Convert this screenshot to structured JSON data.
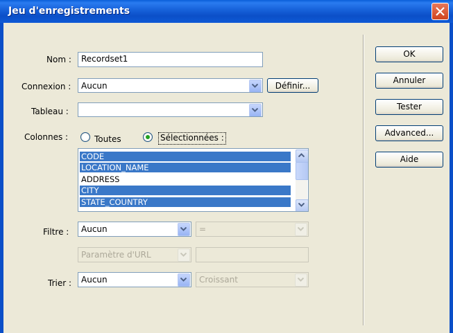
{
  "window": {
    "title": "Jeu d'enregistrements"
  },
  "form": {
    "name_label": "Nom :",
    "name_value": "Recordset1",
    "connection_label": "Connexion :",
    "connection_value": "Aucun",
    "define_button": "Définir...",
    "table_label": "Tableau :",
    "table_value": "",
    "columns_label": "Colonnes :",
    "radio_all_label": "Toutes",
    "radio_selected_label": "Sélectionnées :",
    "columns_list": [
      {
        "label": "CODE",
        "selected": true
      },
      {
        "label": "LOCATION_NAME",
        "selected": true
      },
      {
        "label": "ADDRESS",
        "selected": false
      },
      {
        "label": "CITY",
        "selected": true
      },
      {
        "label": "STATE_COUNTRY",
        "selected": true
      }
    ],
    "filter_label": "Filtre :",
    "filter_value": "Aucun",
    "filter_operator": "=",
    "filter_param": "Paramètre d'URL",
    "filter_param_value": "",
    "sort_label": "Trier :",
    "sort_value": "Aucun",
    "sort_order": "Croissant"
  },
  "buttons": {
    "ok": "OK",
    "cancel": "Annuler",
    "test": "Tester",
    "advanced": "Advanced...",
    "help": "Aide"
  },
  "colors": {
    "title_bar": "#0b4fc8",
    "selection": "#3a78c8",
    "dialog_bg": "#ece9d8"
  }
}
